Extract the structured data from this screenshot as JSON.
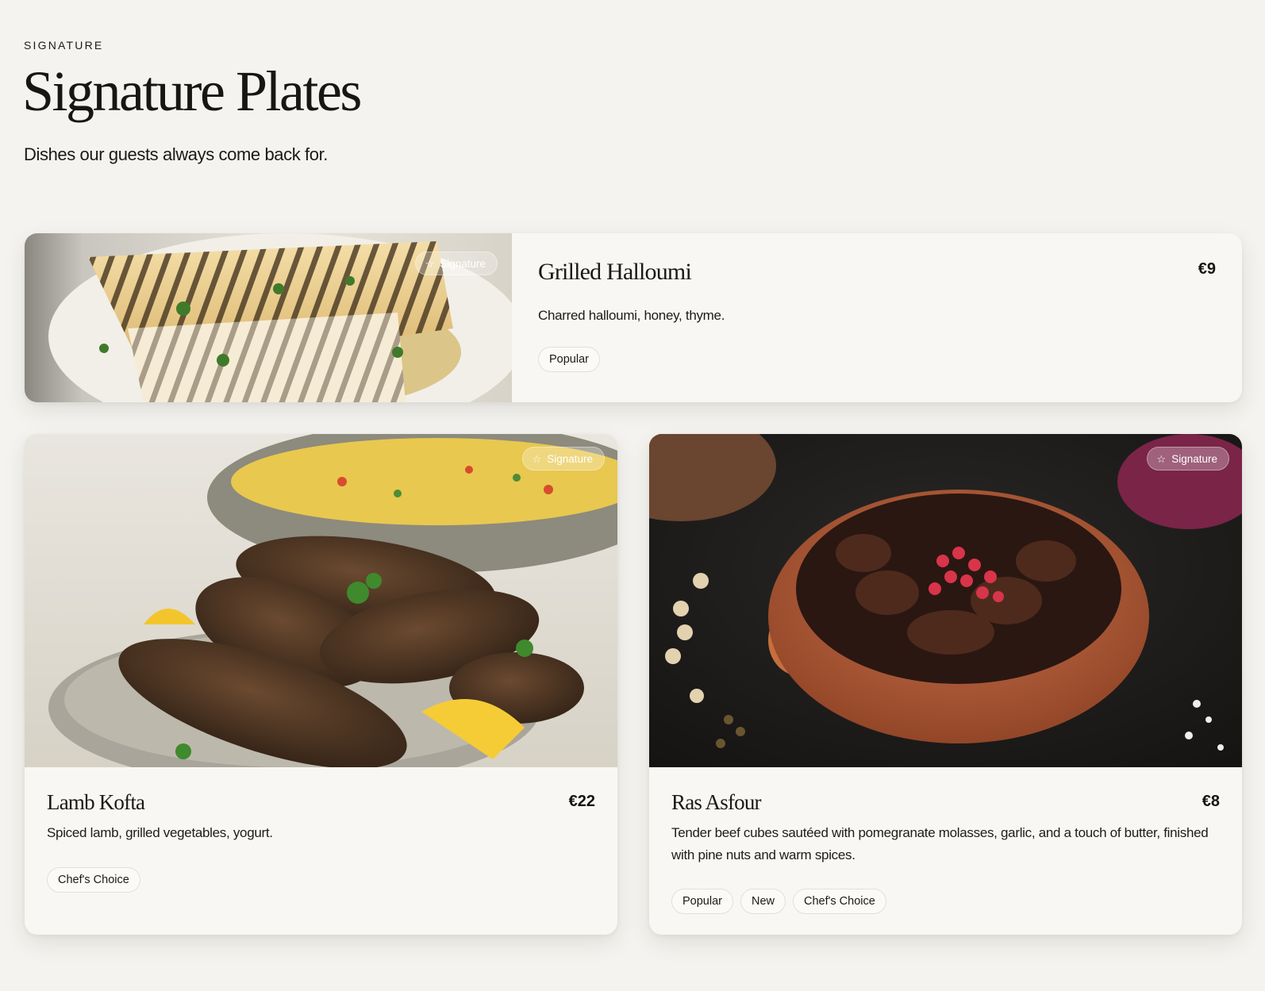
{
  "header": {
    "eyebrow": "SIGNATURE",
    "title": "Signature Plates",
    "subtitle": "Dishes our guests always come back for."
  },
  "dishes": [
    {
      "name": "Grilled Halloumi",
      "price": "€9",
      "description": "Charred halloumi, honey, thyme.",
      "badge": "Signature",
      "tags": [
        "Popular"
      ]
    },
    {
      "name": "Lamb Kofta",
      "price": "€22",
      "description": "Spiced lamb, grilled vegetables, yogurt.",
      "badge": "Signature",
      "tags": [
        "Chef's Choice"
      ]
    },
    {
      "name": "Ras Asfour",
      "price": "€8",
      "description": "Tender beef cubes sautéed with pomegranate molasses, garlic, and a touch of butter, finished with pine nuts and warm spices.",
      "badge": "Signature",
      "tags": [
        "Popular",
        "New",
        "Chef's Choice"
      ]
    }
  ],
  "icons": {
    "badge_icon": "star-outline-icon"
  },
  "colors": {
    "background": "#f4f3ef",
    "card": "#f8f7f3",
    "text": "#1a1917",
    "tag_border": "#e2e0da"
  }
}
